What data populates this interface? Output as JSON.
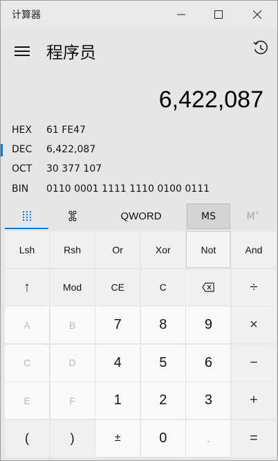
{
  "window": {
    "app_title": "计算器",
    "minimize": "—",
    "maximize": "☐",
    "close": "✕"
  },
  "header": {
    "mode_title": "程序员"
  },
  "display": {
    "value": "6,422,087",
    "radix": [
      {
        "name": "HEX",
        "value": "61 FE47",
        "active": false
      },
      {
        "name": "DEC",
        "value": "6,422,087",
        "active": true
      },
      {
        "name": "OCT",
        "value": "30 377 107",
        "active": false
      },
      {
        "name": "BIN",
        "value": "0110 0001 1111 1110 0100 0111",
        "active": false
      }
    ]
  },
  "toolbar": {
    "word_size": "QWORD",
    "ms": "MS",
    "mv": "M˅"
  },
  "keypad": [
    [
      "Lsh",
      "Rsh",
      "Or",
      "Xor",
      "Not",
      "And"
    ],
    [
      "↑",
      "Mod",
      "CE",
      "C",
      "⌫",
      "÷"
    ],
    [
      "A",
      "B",
      "7",
      "8",
      "9",
      "×"
    ],
    [
      "C",
      "D",
      "4",
      "5",
      "6",
      "−"
    ],
    [
      "E",
      "F",
      "1",
      "2",
      "3",
      "+"
    ],
    [
      "(",
      ")",
      "±",
      "0",
      ".",
      "="
    ]
  ],
  "colors": {
    "accent": "#0078d7",
    "background": "#e6e6e6",
    "number_key": "#fafafa",
    "function_key": "#f0f0f0",
    "disabled_text": "#b8b8b8"
  }
}
